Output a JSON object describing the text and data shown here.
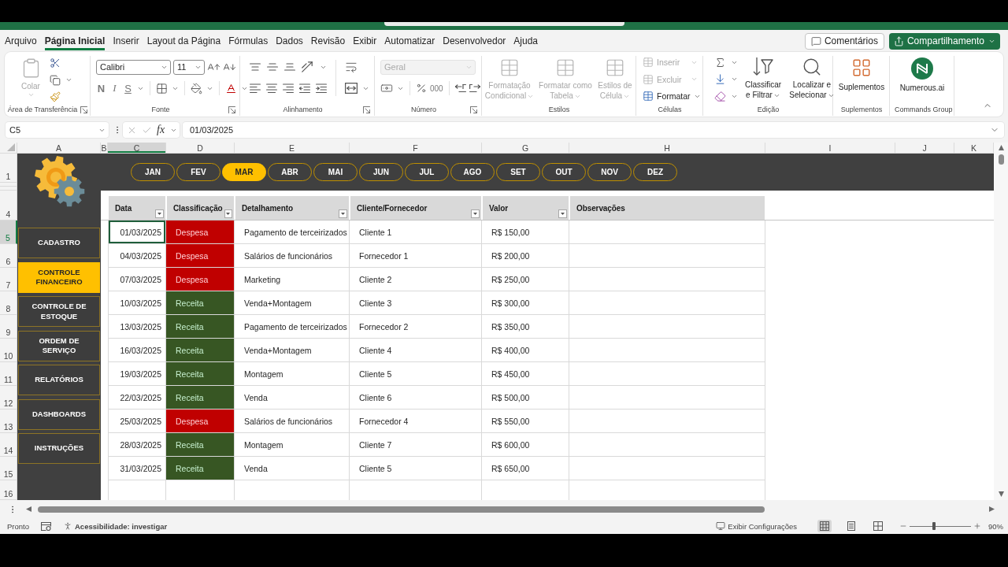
{
  "ribbon_tabs": [
    {
      "label": "Arquivo",
      "selected": false
    },
    {
      "label": "Página Inicial",
      "selected": true
    },
    {
      "label": "Inserir",
      "selected": false
    },
    {
      "label": "Layout da Página",
      "selected": false
    },
    {
      "label": "Fórmulas",
      "selected": false
    },
    {
      "label": "Dados",
      "selected": false
    },
    {
      "label": "Revisão",
      "selected": false
    },
    {
      "label": "Exibir",
      "selected": false
    },
    {
      "label": "Automatizar",
      "selected": false
    },
    {
      "label": "Desenvolvedor",
      "selected": false
    },
    {
      "label": "Ajuda",
      "selected": false
    }
  ],
  "ribbon_actions": {
    "comments": "Comentários",
    "share": "Compartilhamento"
  },
  "ribbon": {
    "clipboard": {
      "label": "Área de Transferência",
      "paste": {
        "label": "Colar",
        "disabled": true
      }
    },
    "font": {
      "label": "Fonte",
      "name": "Calibri",
      "size": "11",
      "bold": "N",
      "italic": "I",
      "underline": "S"
    },
    "alignment": {
      "label": "Alinhamento"
    },
    "number": {
      "label": "Número",
      "format": {
        "value": "Geral",
        "disabled": true
      },
      "thousands": "000"
    },
    "styles": {
      "label": "Estilos",
      "buttons": [
        {
          "label": "Formatação Condicional",
          "disabled": true
        },
        {
          "label": "Formatar como Tabela",
          "disabled": true
        },
        {
          "label": "Estilos de Célula",
          "disabled": true
        }
      ]
    },
    "cells": {
      "label": "Células",
      "buttons": [
        {
          "label": "Inserir",
          "disabled": true
        },
        {
          "label": "Excluir",
          "disabled": true
        },
        {
          "label": "Formatar",
          "disabled": false
        }
      ]
    },
    "editing": {
      "label": "Edição",
      "buttons": [
        {
          "label": "Classificar e Filtrar"
        },
        {
          "label": "Localizar e Selecionar"
        }
      ]
    },
    "addins": {
      "label": "Suplementos",
      "button": "Suplementos"
    },
    "commands": {
      "label": "Commands Group",
      "button": "Numerous.ai"
    }
  },
  "formula_bar": {
    "name_box": "C5",
    "function_label": "fx",
    "formula": "01/03/2025"
  },
  "column_headers": [
    {
      "label": "A",
      "selected": false
    },
    {
      "label": "B",
      "selected": false
    },
    {
      "label": "C",
      "selected": true
    },
    {
      "label": "D",
      "selected": false
    },
    {
      "label": "E",
      "selected": false
    },
    {
      "label": "F",
      "selected": false
    },
    {
      "label": "G",
      "selected": false
    },
    {
      "label": "H",
      "selected": false
    },
    {
      "label": "I",
      "selected": false
    },
    {
      "label": "J",
      "selected": false
    },
    {
      "label": "K",
      "selected": false
    }
  ],
  "row_headers": [
    {
      "label": "1",
      "selected": false
    },
    {
      "label": "4",
      "selected": false
    },
    {
      "label": "5",
      "selected": true
    },
    {
      "label": "6",
      "selected": false
    },
    {
      "label": "7",
      "selected": false
    },
    {
      "label": "8",
      "selected": false
    },
    {
      "label": "9",
      "selected": false
    },
    {
      "label": "10",
      "selected": false
    },
    {
      "label": "11",
      "selected": false
    },
    {
      "label": "12",
      "selected": false
    },
    {
      "label": "13",
      "selected": false
    },
    {
      "label": "14",
      "selected": false
    },
    {
      "label": "15",
      "selected": false
    },
    {
      "label": "16",
      "selected": false
    }
  ],
  "months": [
    {
      "label": "JAN",
      "selected": false
    },
    {
      "label": "FEV",
      "selected": false
    },
    {
      "label": "MAR",
      "selected": true
    },
    {
      "label": "ABR",
      "selected": false
    },
    {
      "label": "MAI",
      "selected": false
    },
    {
      "label": "JUN",
      "selected": false
    },
    {
      "label": "JUL",
      "selected": false
    },
    {
      "label": "AGO",
      "selected": false
    },
    {
      "label": "SET",
      "selected": false
    },
    {
      "label": "OUT",
      "selected": false
    },
    {
      "label": "NOV",
      "selected": false
    },
    {
      "label": "DEZ",
      "selected": false
    }
  ],
  "nav": [
    {
      "label": "CADASTRO",
      "selected": false
    },
    {
      "label": "CONTROLE FINANCEIRO",
      "selected": true
    },
    {
      "label": "CONTROLE DE ESTOQUE",
      "selected": false
    },
    {
      "label": "ORDEM DE SERVIÇO",
      "selected": false
    },
    {
      "label": "RELATÓRIOS",
      "selected": false
    },
    {
      "label": "DASHBOARDS",
      "selected": false
    },
    {
      "label": "INSTRUÇÕES",
      "selected": false
    }
  ],
  "table": {
    "columns": [
      {
        "label": "Data",
        "filter": true
      },
      {
        "label": "Classificação",
        "filter": true
      },
      {
        "label": "Detalhamento",
        "filter": true
      },
      {
        "label": "Cliente/Fornecedor",
        "filter": true
      },
      {
        "label": "Valor",
        "filter": true
      },
      {
        "label": "Observações",
        "filter": false
      }
    ],
    "rows": [
      {
        "date": "01/03/2025",
        "selected": true,
        "classification": {
          "label": "Despesa",
          "kind": "expense"
        },
        "detail": "Pagamento de terceirizados",
        "party": "Cliente 1",
        "value": "R$ 150,00"
      },
      {
        "date": "04/03/2025",
        "selected": false,
        "classification": {
          "label": "Despesa",
          "kind": "expense"
        },
        "detail": "Salários de funcionários",
        "party": "Fornecedor 1",
        "value": "R$ 200,00"
      },
      {
        "date": "07/03/2025",
        "selected": false,
        "classification": {
          "label": "Despesa",
          "kind": "expense"
        },
        "detail": "Marketing",
        "party": "Cliente 2",
        "value": "R$ 250,00"
      },
      {
        "date": "10/03/2025",
        "selected": false,
        "classification": {
          "label": "Receita",
          "kind": "income"
        },
        "detail": "Venda+Montagem",
        "party": "Cliente 3",
        "value": "R$ 300,00"
      },
      {
        "date": "13/03/2025",
        "selected": false,
        "classification": {
          "label": "Receita",
          "kind": "income"
        },
        "detail": "Pagamento de terceirizados",
        "party": "Fornecedor 2",
        "value": "R$ 350,00"
      },
      {
        "date": "16/03/2025",
        "selected": false,
        "classification": {
          "label": "Receita",
          "kind": "income"
        },
        "detail": "Venda+Montagem",
        "party": "Cliente 4",
        "value": "R$ 400,00"
      },
      {
        "date": "19/03/2025",
        "selected": false,
        "classification": {
          "label": "Receita",
          "kind": "income"
        },
        "detail": "Montagem",
        "party": "Cliente 5",
        "value": "R$ 450,00"
      },
      {
        "date": "22/03/2025",
        "selected": false,
        "classification": {
          "label": "Receita",
          "kind": "income"
        },
        "detail": "Venda",
        "party": "Cliente 6",
        "value": "R$ 500,00"
      },
      {
        "date": "25/03/2025",
        "selected": false,
        "classification": {
          "label": "Despesa",
          "kind": "expense"
        },
        "detail": "Salários de funcionários",
        "party": "Fornecedor 4",
        "value": "R$ 550,00"
      },
      {
        "date": "28/03/2025",
        "selected": false,
        "classification": {
          "label": "Receita",
          "kind": "income"
        },
        "detail": "Montagem",
        "party": "Cliente 7",
        "value": "R$ 600,00"
      },
      {
        "date": "31/03/2025",
        "selected": false,
        "classification": {
          "label": "Receita",
          "kind": "income"
        },
        "detail": "Venda",
        "party": "Cliente 5",
        "value": "R$ 650,00"
      }
    ]
  },
  "status_bar": {
    "ready": "Pronto",
    "accessibility": "Acessibilidade: investigar",
    "display_settings": "Exibir Configurações",
    "views": [
      {
        "kind": "normal",
        "selected": true
      },
      {
        "kind": "page_layout",
        "selected": false
      },
      {
        "kind": "page_break",
        "selected": false
      }
    ],
    "zoom": {
      "level": 0.4,
      "reading": "90%"
    }
  }
}
